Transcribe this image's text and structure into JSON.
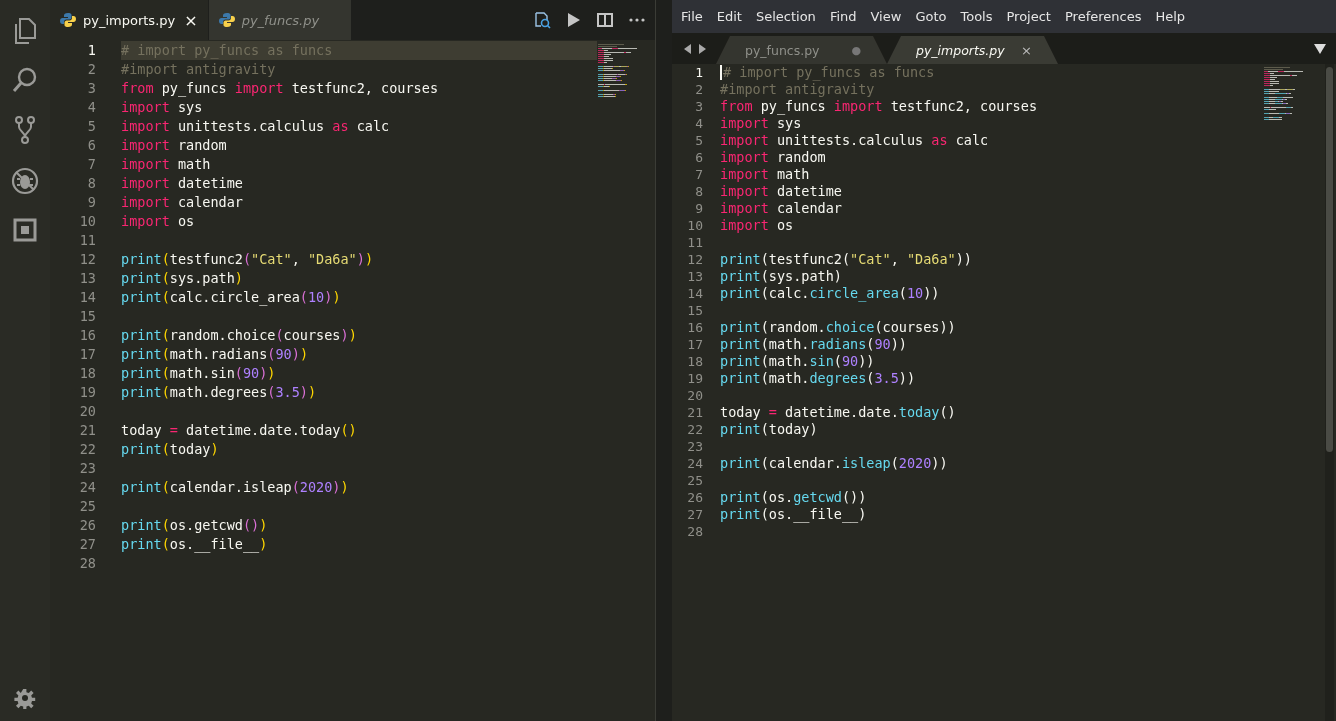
{
  "left_editor": {
    "tabs": [
      {
        "label": "py_imports.py",
        "selected": true,
        "preview": false,
        "close": "×"
      },
      {
        "label": "py_funcs.py",
        "selected": false,
        "preview": true
      }
    ],
    "lines": [
      {
        "number": "1",
        "current": true,
        "tokens": [
          {
            "text": "# import py_funcs as funcs",
            "kind": "cmt"
          }
        ]
      },
      {
        "number": "2",
        "current": false,
        "tokens": [
          {
            "text": "#import antigravity",
            "kind": "cmt"
          }
        ]
      },
      {
        "number": "3",
        "current": false,
        "tokens": [
          {
            "text": "from",
            "kind": "kw"
          },
          {
            "text": " py_funcs ",
            "kind": "id"
          },
          {
            "text": "import",
            "kind": "kw"
          },
          {
            "text": " testfunc2, courses",
            "kind": "id"
          }
        ]
      },
      {
        "number": "4",
        "current": false,
        "tokens": [
          {
            "text": "import",
            "kind": "kw"
          },
          {
            "text": " sys",
            "kind": "id"
          }
        ]
      },
      {
        "number": "5",
        "current": false,
        "tokens": [
          {
            "text": "import",
            "kind": "kw"
          },
          {
            "text": " unittests.calculus ",
            "kind": "id"
          },
          {
            "text": "as",
            "kind": "kw"
          },
          {
            "text": " calc",
            "kind": "id"
          }
        ]
      },
      {
        "number": "6",
        "current": false,
        "tokens": [
          {
            "text": "import",
            "kind": "kw"
          },
          {
            "text": " random",
            "kind": "id"
          }
        ]
      },
      {
        "number": "7",
        "current": false,
        "tokens": [
          {
            "text": "import",
            "kind": "kw"
          },
          {
            "text": " math",
            "kind": "id"
          }
        ]
      },
      {
        "number": "8",
        "current": false,
        "tokens": [
          {
            "text": "import",
            "kind": "kw"
          },
          {
            "text": " datetime",
            "kind": "id"
          }
        ]
      },
      {
        "number": "9",
        "current": false,
        "tokens": [
          {
            "text": "import",
            "kind": "kw"
          },
          {
            "text": " calendar",
            "kind": "id"
          }
        ]
      },
      {
        "number": "10",
        "current": false,
        "tokens": [
          {
            "text": "import",
            "kind": "kw"
          },
          {
            "text": " os",
            "kind": "id"
          }
        ]
      },
      {
        "number": "11",
        "current": false
      },
      {
        "number": "12",
        "current": false,
        "tokens": [
          {
            "text": "print",
            "kind": "fn"
          },
          {
            "text": "(",
            "kind": "b1"
          },
          {
            "text": "testfunc2",
            "kind": "id"
          },
          {
            "text": "(",
            "kind": "b2"
          },
          {
            "text": "\"Cat\"",
            "kind": "str"
          },
          {
            "text": ", ",
            "kind": "id"
          },
          {
            "text": "\"Da6a\"",
            "kind": "str"
          },
          {
            "text": ")",
            "kind": "b2"
          },
          {
            "text": ")",
            "kind": "b1"
          }
        ]
      },
      {
        "number": "13",
        "current": false,
        "tokens": [
          {
            "text": "print",
            "kind": "fn"
          },
          {
            "text": "(",
            "kind": "b1"
          },
          {
            "text": "sys.path",
            "kind": "id"
          },
          {
            "text": ")",
            "kind": "b1"
          }
        ]
      },
      {
        "number": "14",
        "current": false,
        "tokens": [
          {
            "text": "print",
            "kind": "fn"
          },
          {
            "text": "(",
            "kind": "b1"
          },
          {
            "text": "calc.circle_area",
            "kind": "id"
          },
          {
            "text": "(",
            "kind": "b2"
          },
          {
            "text": "10",
            "kind": "num"
          },
          {
            "text": ")",
            "kind": "b2"
          },
          {
            "text": ")",
            "kind": "b1"
          }
        ]
      },
      {
        "number": "15",
        "current": false
      },
      {
        "number": "16",
        "current": false,
        "tokens": [
          {
            "text": "print",
            "kind": "fn"
          },
          {
            "text": "(",
            "kind": "b1"
          },
          {
            "text": "random.choice",
            "kind": "id"
          },
          {
            "text": "(",
            "kind": "b2"
          },
          {
            "text": "courses",
            "kind": "id"
          },
          {
            "text": ")",
            "kind": "b2"
          },
          {
            "text": ")",
            "kind": "b1"
          }
        ]
      },
      {
        "number": "17",
        "current": false,
        "tokens": [
          {
            "text": "print",
            "kind": "fn"
          },
          {
            "text": "(",
            "kind": "b1"
          },
          {
            "text": "math.radians",
            "kind": "id"
          },
          {
            "text": "(",
            "kind": "b2"
          },
          {
            "text": "90",
            "kind": "num"
          },
          {
            "text": ")",
            "kind": "b2"
          },
          {
            "text": ")",
            "kind": "b1"
          }
        ]
      },
      {
        "number": "18",
        "current": false,
        "tokens": [
          {
            "text": "print",
            "kind": "fn"
          },
          {
            "text": "(",
            "kind": "b1"
          },
          {
            "text": "math.sin",
            "kind": "id"
          },
          {
            "text": "(",
            "kind": "b2"
          },
          {
            "text": "90",
            "kind": "num"
          },
          {
            "text": ")",
            "kind": "b2"
          },
          {
            "text": ")",
            "kind": "b1"
          }
        ]
      },
      {
        "number": "19",
        "current": false,
        "tokens": [
          {
            "text": "print",
            "kind": "fn"
          },
          {
            "text": "(",
            "kind": "b1"
          },
          {
            "text": "math.degrees",
            "kind": "id"
          },
          {
            "text": "(",
            "kind": "b2"
          },
          {
            "text": "3.5",
            "kind": "num"
          },
          {
            "text": ")",
            "kind": "b2"
          },
          {
            "text": ")",
            "kind": "b1"
          }
        ]
      },
      {
        "number": "20",
        "current": false
      },
      {
        "number": "21",
        "current": false,
        "tokens": [
          {
            "text": "today ",
            "kind": "id"
          },
          {
            "text": "=",
            "kind": "op"
          },
          {
            "text": " datetime.date.today",
            "kind": "id"
          },
          {
            "text": "()",
            "kind": "b1"
          }
        ]
      },
      {
        "number": "22",
        "current": false,
        "tokens": [
          {
            "text": "print",
            "kind": "fn"
          },
          {
            "text": "(",
            "kind": "b1"
          },
          {
            "text": "today",
            "kind": "id"
          },
          {
            "text": ")",
            "kind": "b1"
          }
        ]
      },
      {
        "number": "23",
        "current": false
      },
      {
        "number": "24",
        "current": false,
        "tokens": [
          {
            "text": "print",
            "kind": "fn"
          },
          {
            "text": "(",
            "kind": "b1"
          },
          {
            "text": "calendar.isleap",
            "kind": "id"
          },
          {
            "text": "(",
            "kind": "b2"
          },
          {
            "text": "2020",
            "kind": "num"
          },
          {
            "text": ")",
            "kind": "b2"
          },
          {
            "text": ")",
            "kind": "b1"
          }
        ]
      },
      {
        "number": "25",
        "current": false
      },
      {
        "number": "26",
        "current": false,
        "tokens": [
          {
            "text": "print",
            "kind": "fn"
          },
          {
            "text": "(",
            "kind": "b1"
          },
          {
            "text": "os.getcwd",
            "kind": "id"
          },
          {
            "text": "()",
            "kind": "b2"
          },
          {
            "text": ")",
            "kind": "b1"
          }
        ]
      },
      {
        "number": "27",
        "current": false,
        "tokens": [
          {
            "text": "print",
            "kind": "fn"
          },
          {
            "text": "(",
            "kind": "b1"
          },
          {
            "text": "os.__file__",
            "kind": "id"
          },
          {
            "text": ")",
            "kind": "b1"
          }
        ]
      },
      {
        "number": "28",
        "current": false
      }
    ]
  },
  "right_editor": {
    "menu": [
      "File",
      "Edit",
      "Selection",
      "Find",
      "View",
      "Goto",
      "Tools",
      "Project",
      "Preferences",
      "Help"
    ],
    "tabs": [
      {
        "label": "py_funcs.py",
        "selected": false,
        "modified": true,
        "close": "●"
      },
      {
        "label": "py_imports.py",
        "selected": true,
        "modified": false,
        "close": "×"
      }
    ],
    "lines": [
      {
        "number": "1",
        "current": true,
        "tokens": [
          {
            "text": "# import py_funcs as funcs",
            "kind": "cmt"
          }
        ]
      },
      {
        "number": "2",
        "current": false,
        "tokens": [
          {
            "text": "#import antigravity",
            "kind": "cmt"
          }
        ]
      },
      {
        "number": "3",
        "current": false,
        "tokens": [
          {
            "text": "from",
            "kind": "kw"
          },
          {
            "text": " py_funcs ",
            "kind": "id"
          },
          {
            "text": "import",
            "kind": "kw"
          },
          {
            "text": " testfunc2, courses",
            "kind": "id"
          }
        ]
      },
      {
        "number": "4",
        "current": false,
        "tokens": [
          {
            "text": "import",
            "kind": "kw"
          },
          {
            "text": " sys",
            "kind": "id"
          }
        ]
      },
      {
        "number": "5",
        "current": false,
        "tokens": [
          {
            "text": "import",
            "kind": "kw"
          },
          {
            "text": " unittests.calculus ",
            "kind": "id"
          },
          {
            "text": "as",
            "kind": "kw"
          },
          {
            "text": " calc",
            "kind": "id"
          }
        ]
      },
      {
        "number": "6",
        "current": false,
        "tokens": [
          {
            "text": "import",
            "kind": "kw"
          },
          {
            "text": " random",
            "kind": "id"
          }
        ]
      },
      {
        "number": "7",
        "current": false,
        "tokens": [
          {
            "text": "import",
            "kind": "kw"
          },
          {
            "text": " math",
            "kind": "id"
          }
        ]
      },
      {
        "number": "8",
        "current": false,
        "tokens": [
          {
            "text": "import",
            "kind": "kw"
          },
          {
            "text": " datetime",
            "kind": "id"
          }
        ]
      },
      {
        "number": "9",
        "current": false,
        "tokens": [
          {
            "text": "import",
            "kind": "kw"
          },
          {
            "text": " calendar",
            "kind": "id"
          }
        ]
      },
      {
        "number": "10",
        "current": false,
        "tokens": [
          {
            "text": "import",
            "kind": "kw"
          },
          {
            "text": " os",
            "kind": "id"
          }
        ]
      },
      {
        "number": "11",
        "current": false
      },
      {
        "number": "12",
        "current": false,
        "tokens": [
          {
            "text": "print",
            "kind": "fn"
          },
          {
            "text": "(testfunc2(",
            "kind": "id"
          },
          {
            "text": "\"Cat\"",
            "kind": "str"
          },
          {
            "text": ", ",
            "kind": "id"
          },
          {
            "text": "\"Da6a\"",
            "kind": "str"
          },
          {
            "text": "))",
            "kind": "id"
          }
        ]
      },
      {
        "number": "13",
        "current": false,
        "tokens": [
          {
            "text": "print",
            "kind": "fn"
          },
          {
            "text": "(sys.path)",
            "kind": "id"
          }
        ]
      },
      {
        "number": "14",
        "current": false,
        "tokens": [
          {
            "text": "print",
            "kind": "fn"
          },
          {
            "text": "(calc.",
            "kind": "id"
          },
          {
            "text": "circle_area",
            "kind": "fn"
          },
          {
            "text": "(",
            "kind": "id"
          },
          {
            "text": "10",
            "kind": "num"
          },
          {
            "text": "))",
            "kind": "id"
          }
        ]
      },
      {
        "number": "15",
        "current": false
      },
      {
        "number": "16",
        "current": false,
        "tokens": [
          {
            "text": "print",
            "kind": "fn"
          },
          {
            "text": "(random.",
            "kind": "id"
          },
          {
            "text": "choice",
            "kind": "fn"
          },
          {
            "text": "(courses))",
            "kind": "id"
          }
        ]
      },
      {
        "number": "17",
        "current": false,
        "tokens": [
          {
            "text": "print",
            "kind": "fn"
          },
          {
            "text": "(math.",
            "kind": "id"
          },
          {
            "text": "radians",
            "kind": "fn"
          },
          {
            "text": "(",
            "kind": "id"
          },
          {
            "text": "90",
            "kind": "num"
          },
          {
            "text": "))",
            "kind": "id"
          }
        ]
      },
      {
        "number": "18",
        "current": false,
        "tokens": [
          {
            "text": "print",
            "kind": "fn"
          },
          {
            "text": "(math.",
            "kind": "id"
          },
          {
            "text": "sin",
            "kind": "fn"
          },
          {
            "text": "(",
            "kind": "id"
          },
          {
            "text": "90",
            "kind": "num"
          },
          {
            "text": "))",
            "kind": "id"
          }
        ]
      },
      {
        "number": "19",
        "current": false,
        "tokens": [
          {
            "text": "print",
            "kind": "fn"
          },
          {
            "text": "(math.",
            "kind": "id"
          },
          {
            "text": "degrees",
            "kind": "fn"
          },
          {
            "text": "(",
            "kind": "id"
          },
          {
            "text": "3.5",
            "kind": "num"
          },
          {
            "text": "))",
            "kind": "id"
          }
        ]
      },
      {
        "number": "20",
        "current": false
      },
      {
        "number": "21",
        "current": false,
        "tokens": [
          {
            "text": "today ",
            "kind": "id"
          },
          {
            "text": "=",
            "kind": "op"
          },
          {
            "text": " datetime.date.",
            "kind": "id"
          },
          {
            "text": "today",
            "kind": "fn"
          },
          {
            "text": "()",
            "kind": "id"
          }
        ]
      },
      {
        "number": "22",
        "current": false,
        "tokens": [
          {
            "text": "print",
            "kind": "fn"
          },
          {
            "text": "(today)",
            "kind": "id"
          }
        ]
      },
      {
        "number": "23",
        "current": false
      },
      {
        "number": "24",
        "current": false,
        "tokens": [
          {
            "text": "print",
            "kind": "fn"
          },
          {
            "text": "(calendar.",
            "kind": "id"
          },
          {
            "text": "isleap",
            "kind": "fn"
          },
          {
            "text": "(",
            "kind": "id"
          },
          {
            "text": "2020",
            "kind": "num"
          },
          {
            "text": "))",
            "kind": "id"
          }
        ]
      },
      {
        "number": "25",
        "current": false
      },
      {
        "number": "26",
        "current": false,
        "tokens": [
          {
            "text": "print",
            "kind": "fn"
          },
          {
            "text": "(os.",
            "kind": "id"
          },
          {
            "text": "getcwd",
            "kind": "fn"
          },
          {
            "text": "())",
            "kind": "id"
          }
        ]
      },
      {
        "number": "27",
        "current": false,
        "tokens": [
          {
            "text": "print",
            "kind": "fn"
          },
          {
            "text": "(os.__file__)",
            "kind": "id"
          }
        ]
      },
      {
        "number": "28",
        "current": false
      }
    ]
  }
}
